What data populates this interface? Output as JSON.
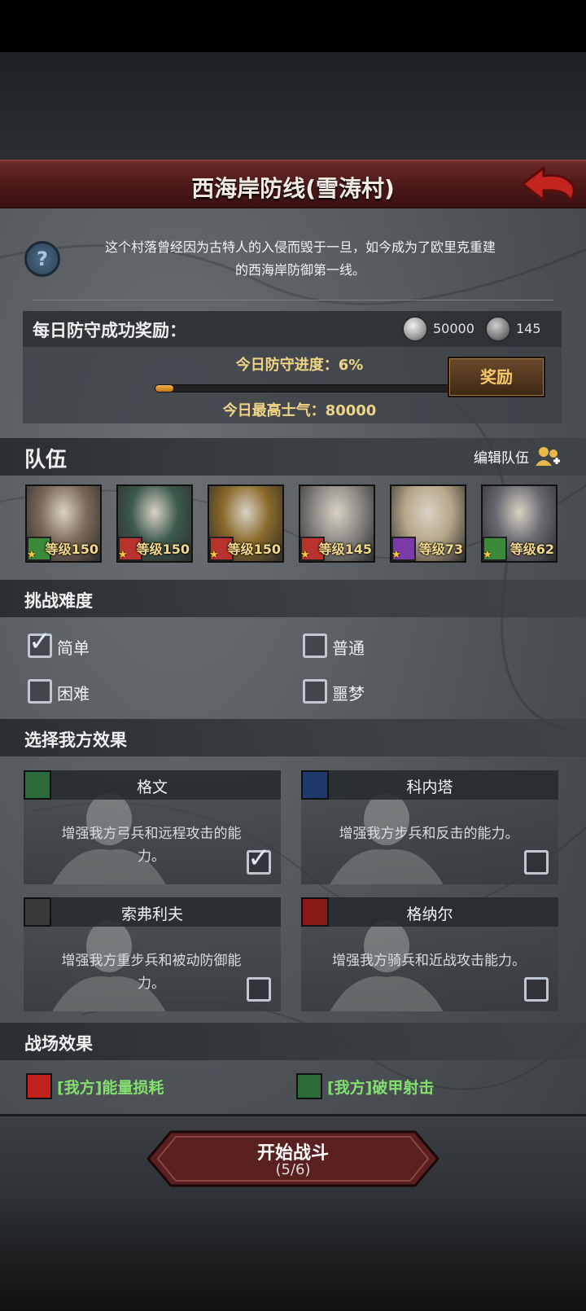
{
  "header": {
    "title": "西海岸防线(雪涛村)"
  },
  "intro": {
    "line1": "这个村落曾经因为古特人的入侵而毁于一旦，如今成为了欧里克重建",
    "line2": "的西海岸防御第一线。"
  },
  "reward": {
    "label": "每日防守成功奖励：",
    "silver_amount": "50000",
    "stone_amount": "145",
    "progress_text": "今日防守进度：6%",
    "progress_fraction": 0.06,
    "morale_text": "今日最高士气：80000",
    "button_label": "奖励"
  },
  "team": {
    "title": "队伍",
    "edit_label": "编辑队伍",
    "heroes": [
      {
        "level": "等级150",
        "class_color": "#3a8a3a",
        "art": "#7d6a5a"
      },
      {
        "level": "等级150",
        "class_color": "#b8332d",
        "art": "#3d5a4e"
      },
      {
        "level": "等级150",
        "class_color": "#b8332d",
        "art": "#8a6a2a"
      },
      {
        "level": "等级145",
        "class_color": "#b8332d",
        "art": "#8d8a86"
      },
      {
        "level": "等级73",
        "class_color": "#7b3aa8",
        "art": "#b7a78a"
      },
      {
        "level": "等级62",
        "class_color": "#3a8a3a",
        "art": "#6a6a72"
      }
    ]
  },
  "difficulty": {
    "title": "挑战难度",
    "options": [
      {
        "label": "简单",
        "checked": true
      },
      {
        "label": "普通",
        "checked": false
      },
      {
        "label": "困难",
        "checked": false
      },
      {
        "label": "噩梦",
        "checked": false
      }
    ]
  },
  "effects": {
    "title": "选择我方效果",
    "cards": [
      {
        "name": "格文",
        "desc": "增强我方弓兵和远程攻击的能力。",
        "checked": true,
        "icon_color": "#2d6a3a"
      },
      {
        "name": "科内塔",
        "desc": "增强我方步兵和反击的能力。",
        "checked": false,
        "icon_color": "#1e3a6a"
      },
      {
        "name": "索弗利夫",
        "desc": "增强我方重步兵和被动防御能力。",
        "checked": false,
        "icon_color": "#3a3a3a"
      },
      {
        "name": "格纳尔",
        "desc": "增强我方骑兵和近战攻击能力。",
        "checked": false,
        "icon_color": "#8a1a1a"
      }
    ]
  },
  "battlefield": {
    "title": "战场效果",
    "items": [
      {
        "label": "[我方]能量损耗",
        "icon_color": "#c0201e"
      },
      {
        "label": "[我方]破甲射击",
        "icon_color": "#2d6a3a"
      }
    ]
  },
  "start": {
    "label": "开始战斗",
    "count": "(5/6)"
  }
}
